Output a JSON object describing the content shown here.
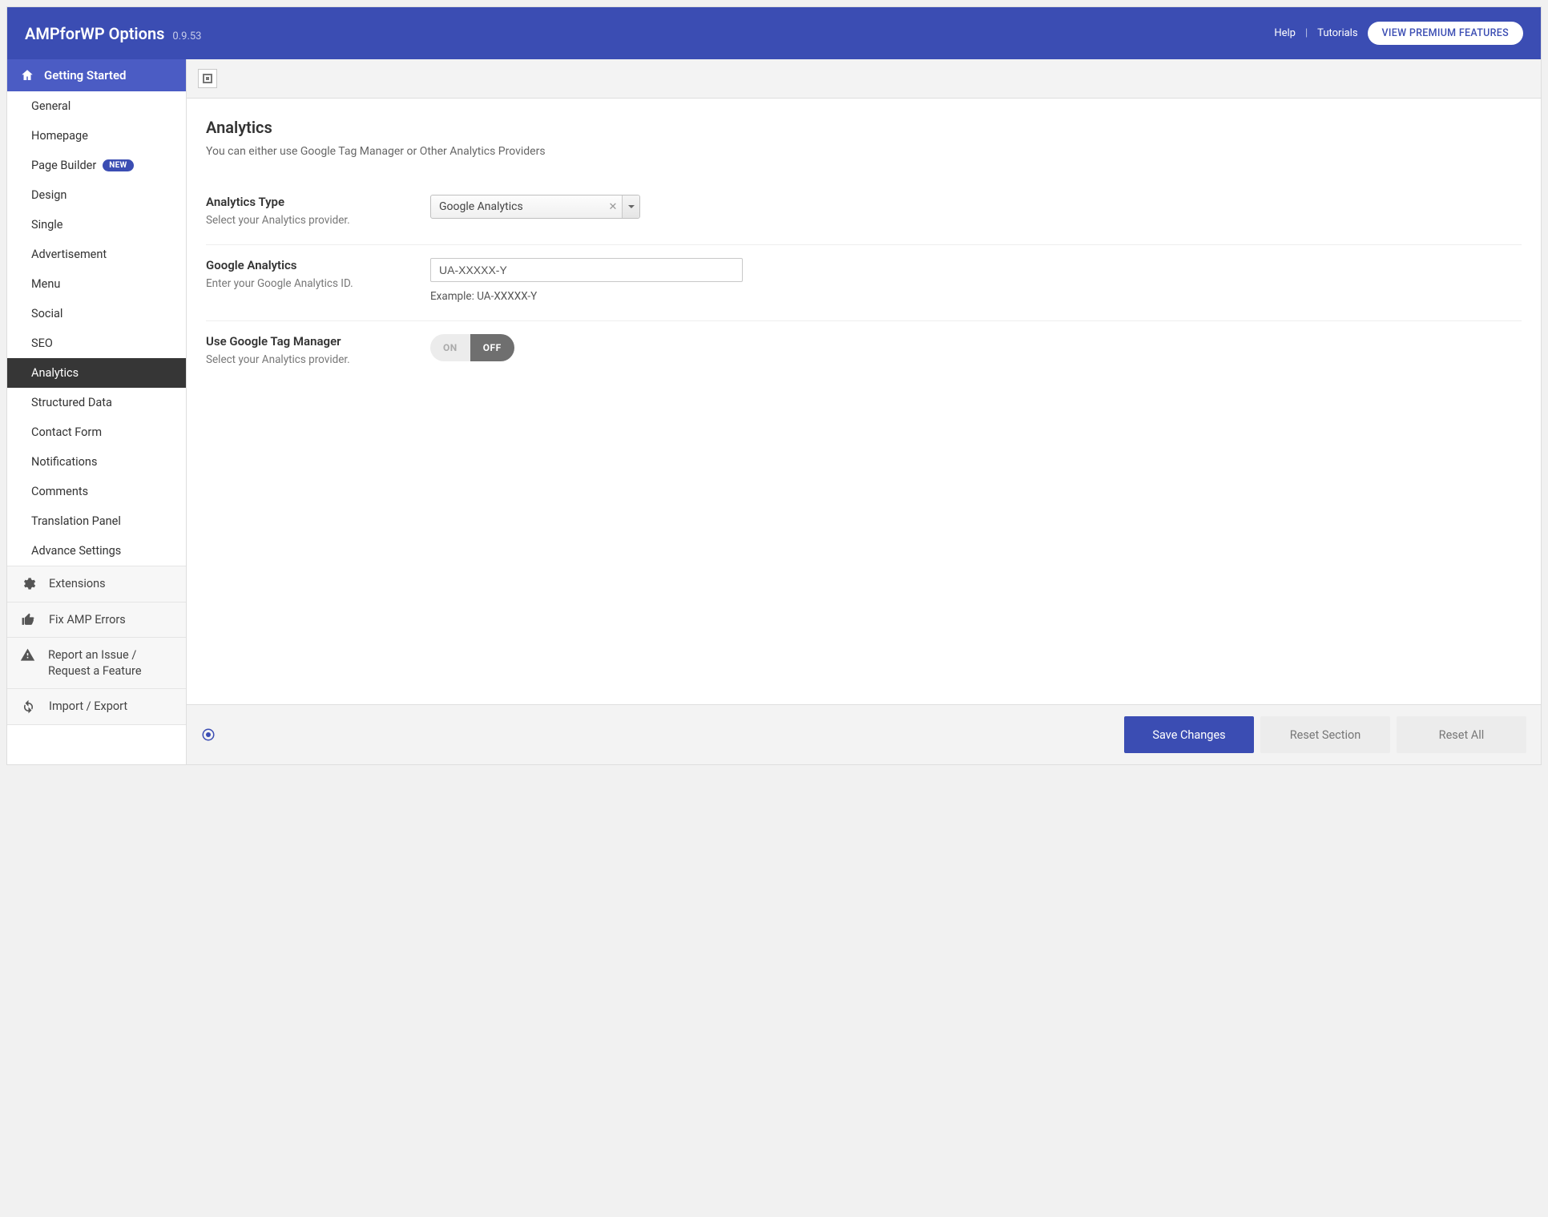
{
  "header": {
    "title": "AMPforWP Options",
    "version": "0.9.53",
    "help": "Help",
    "tutorials": "Tutorials",
    "premium_btn": "VIEW PREMIUM FEATURES"
  },
  "sidebar": {
    "head": "Getting Started",
    "items": [
      {
        "label": "General"
      },
      {
        "label": "Homepage"
      },
      {
        "label": "Page Builder",
        "badge": "NEW"
      },
      {
        "label": "Design"
      },
      {
        "label": "Single"
      },
      {
        "label": "Advertisement"
      },
      {
        "label": "Menu"
      },
      {
        "label": "Social"
      },
      {
        "label": "SEO"
      },
      {
        "label": "Analytics",
        "active": true
      },
      {
        "label": "Structured Data"
      },
      {
        "label": "Contact Form"
      },
      {
        "label": "Notifications"
      },
      {
        "label": "Comments"
      },
      {
        "label": "Translation Panel"
      },
      {
        "label": "Advance Settings"
      }
    ],
    "tools": {
      "extensions": "Extensions",
      "fix_errors": "Fix AMP Errors",
      "report": "Report an Issue / Request a Feature",
      "import_export": "Import / Export"
    }
  },
  "content": {
    "section_title": "Analytics",
    "section_desc": "You can either use Google Tag Manager or Other Analytics Providers",
    "analytics_type": {
      "title": "Analytics Type",
      "desc": "Select your Analytics provider.",
      "value": "Google Analytics"
    },
    "ga": {
      "title": "Google Analytics",
      "desc": "Enter your Google Analytics ID.",
      "value": "UA-XXXXX-Y",
      "example": "Example: UA-XXXXX-Y"
    },
    "gtm": {
      "title": "Use Google Tag Manager",
      "desc": "Select your Analytics provider.",
      "on": "ON",
      "off": "OFF"
    }
  },
  "footer": {
    "save": "Save Changes",
    "reset_section": "Reset Section",
    "reset_all": "Reset All"
  }
}
